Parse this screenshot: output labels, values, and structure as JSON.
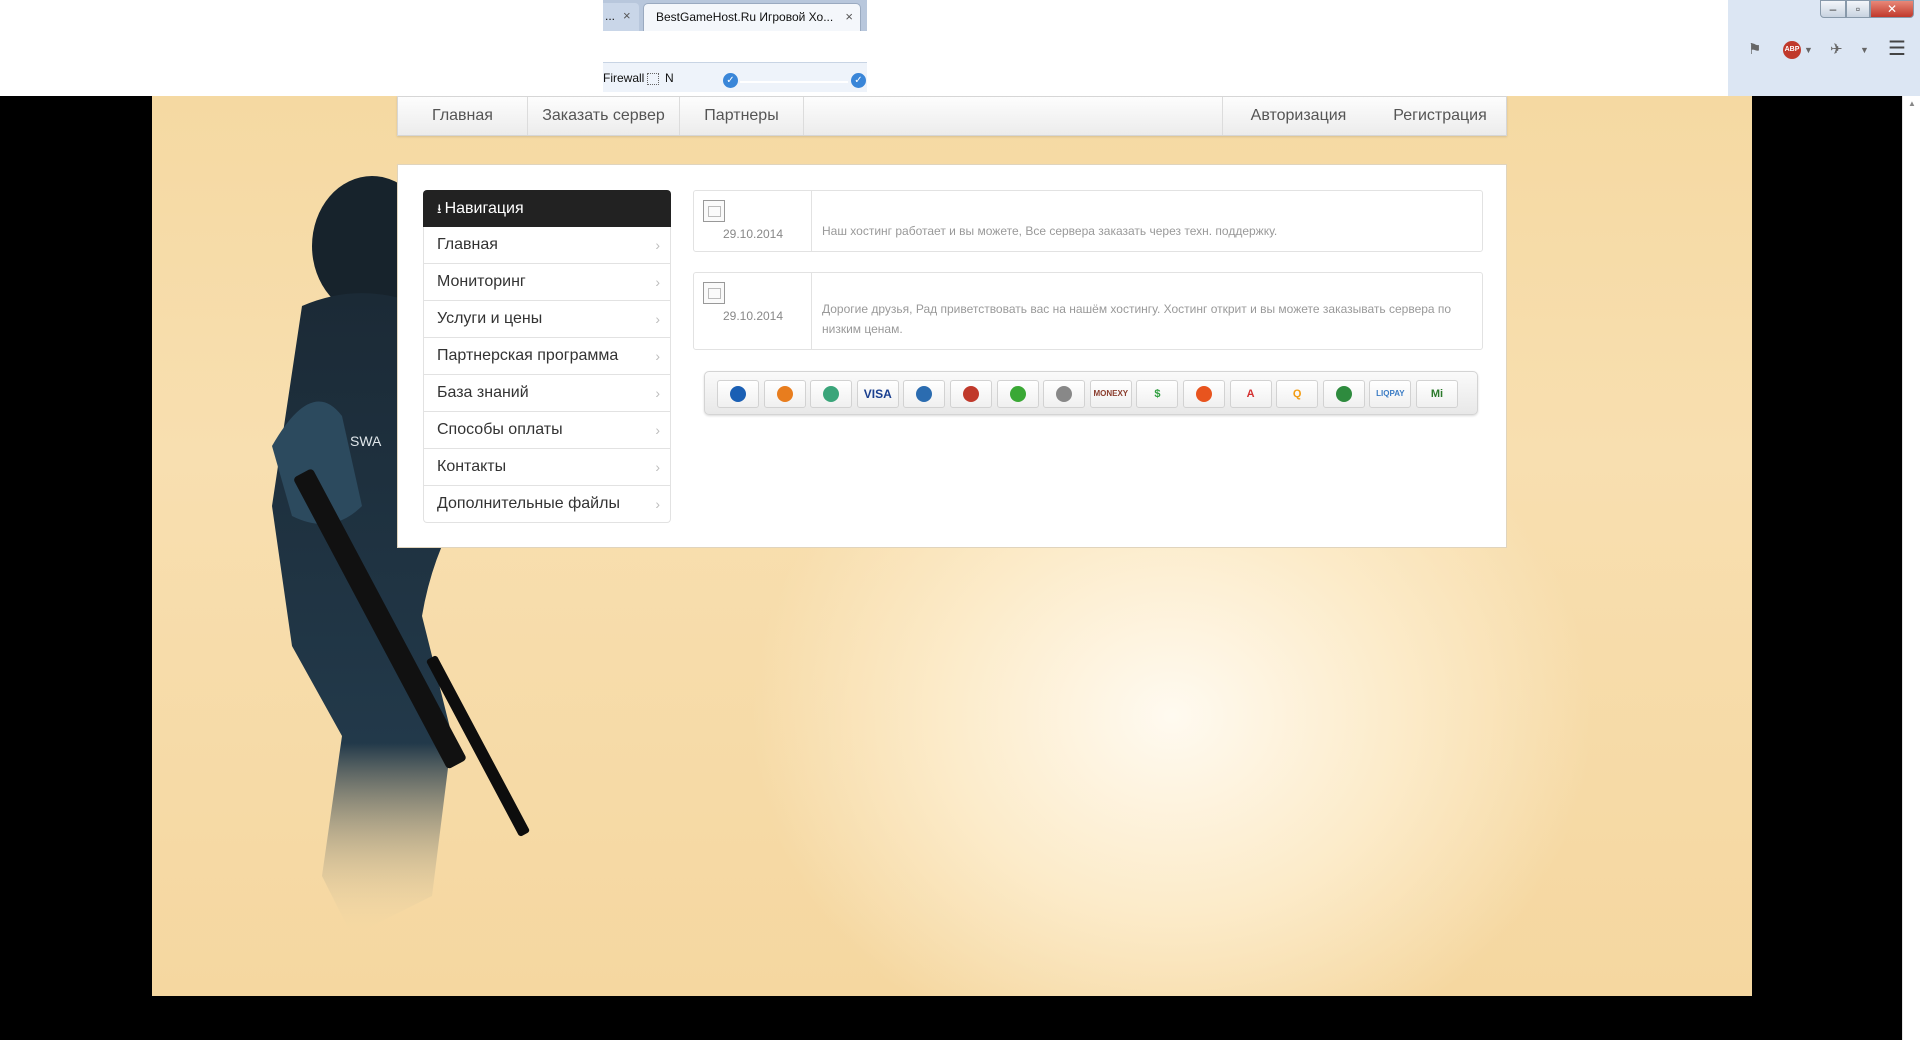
{
  "browser": {
    "tab_prev_label": "...",
    "tab_active_title": "BestGameHost.Ru Игровой Хо...",
    "close_glyph": "×",
    "bookmark_firewall": "Firewall",
    "bookmark_n": "N",
    "window_minimize": "‒",
    "window_maximize": "▫",
    "window_close": "✕"
  },
  "topnav": {
    "home": "Главная",
    "order": "Заказать сервер",
    "partners": "Партнеры",
    "auth": "Авторизация",
    "register": "Регистрация"
  },
  "sidebar": {
    "title": "Навигация",
    "items": [
      {
        "label": "Главная"
      },
      {
        "label": "Мониторинг"
      },
      {
        "label": "Услуги и цены"
      },
      {
        "label": "Партнерская программа"
      },
      {
        "label": "База знаний"
      },
      {
        "label": "Способы оплаты"
      },
      {
        "label": "Контакты"
      },
      {
        "label": "Дополнительные файлы"
      }
    ]
  },
  "news": [
    {
      "date": "29.10.2014",
      "text": "Наш хостинг работает и вы можете, Все сервера заказать через техн. поддержку."
    },
    {
      "date": "29.10.2014",
      "text": "Дорогие друзья, Рад приветствовать вас на нашём хостингу. Хостинг открит и вы можете заказывать сервера по низким ценам."
    }
  ],
  "payments": [
    {
      "name": "webmoney",
      "text": "",
      "color": "#1a5fb4"
    },
    {
      "name": "yandex-money",
      "text": "",
      "color": "#e87d1e"
    },
    {
      "name": "z-payment",
      "text": "",
      "color": "#3aa57a"
    },
    {
      "name": "visa",
      "text": "VISA",
      "color": "#1a3f8f"
    },
    {
      "name": "terminals-ua",
      "text": "",
      "color": "#2b6cb0"
    },
    {
      "name": "terminals-ru",
      "text": "",
      "color": "#c0392b"
    },
    {
      "name": "sberbank",
      "text": "",
      "color": "#3aa835"
    },
    {
      "name": "email-payment",
      "text": "",
      "color": "#888888"
    },
    {
      "name": "monexy",
      "text": "MONEXY",
      "color": "#8a3c2c"
    },
    {
      "name": "dollar-payment",
      "text": "$",
      "color": "#2e9e3e"
    },
    {
      "name": "mastercard",
      "text": "",
      "color": "#e8541e"
    },
    {
      "name": "alfa-bank",
      "text": "A",
      "color": "#d32f2f"
    },
    {
      "name": "qiwi",
      "text": "Q",
      "color": "#f39c12"
    },
    {
      "name": "privat24",
      "text": "",
      "color": "#2e8b3e"
    },
    {
      "name": "liqpay",
      "text": "LIQPAY",
      "color": "#3b7cc4"
    },
    {
      "name": "mobile-payment",
      "text": "Mi",
      "color": "#2b7a2b"
    }
  ]
}
